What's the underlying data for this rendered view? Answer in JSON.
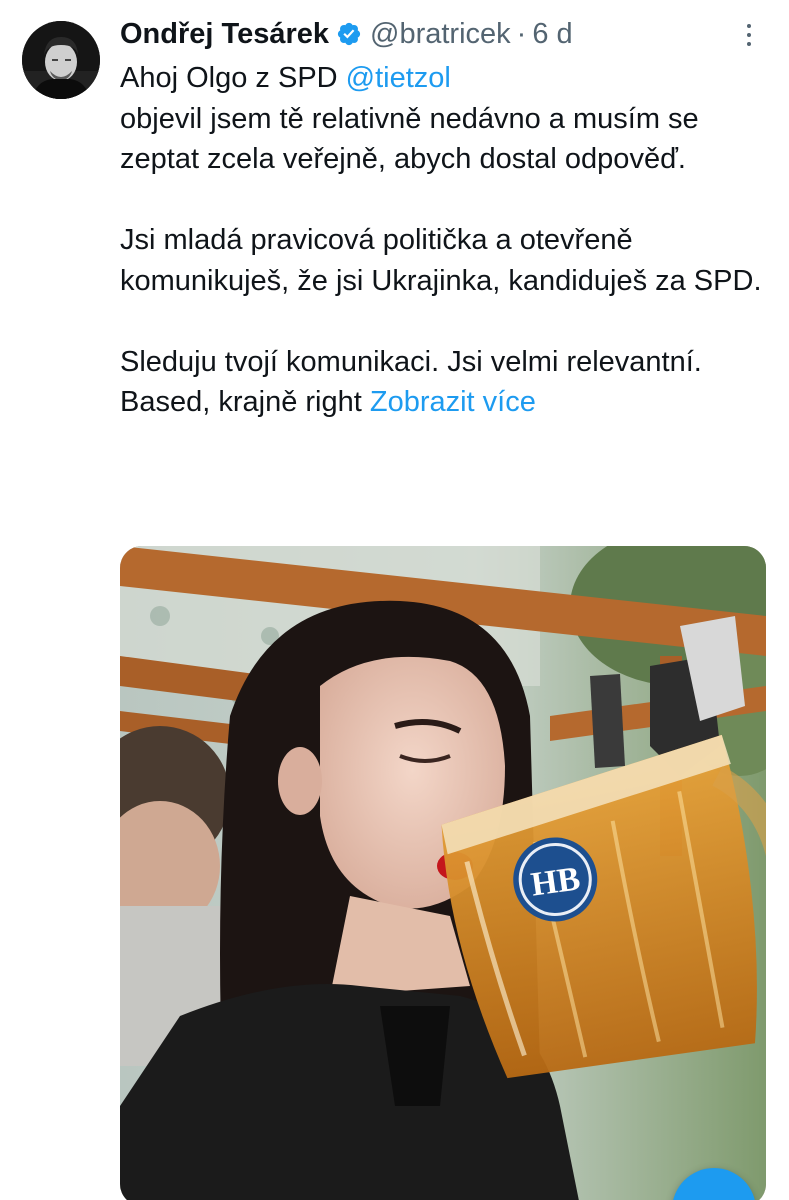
{
  "tweet": {
    "author": {
      "display_name": "Ondřej Tesárek",
      "handle": "@bratricek",
      "verified": true,
      "avatar_icon": "user-avatar-photo"
    },
    "separator": "·",
    "time": "6 d",
    "more_icon": "more-vertical-icon",
    "body": {
      "line1_prefix": "Ahoj Olgo z SPD ",
      "mention": "@tietzol",
      "para1": "objevil jsem tě relativně nedávno a musím se zeptat zcela veřejně, abych dostal odpověď.",
      "para2": "Jsi mladá pravicová politička a otevřeně komunikuješ, že jsi Ukrajinka, kandiduješ za SPD.",
      "para3": "Sleduju tvojí komunikaci. Jsi velmi relevantní. Based, krajně right ",
      "show_more": "Zobrazit více"
    },
    "media": {
      "type": "photo",
      "beer_logo": "HB"
    }
  },
  "colors": {
    "link": "#1d9bf0",
    "secondary_text": "#536471",
    "primary_text": "#0f1419",
    "verified_badge": "#1d9bf0"
  },
  "fab": {
    "icon": "compose-icon"
  }
}
